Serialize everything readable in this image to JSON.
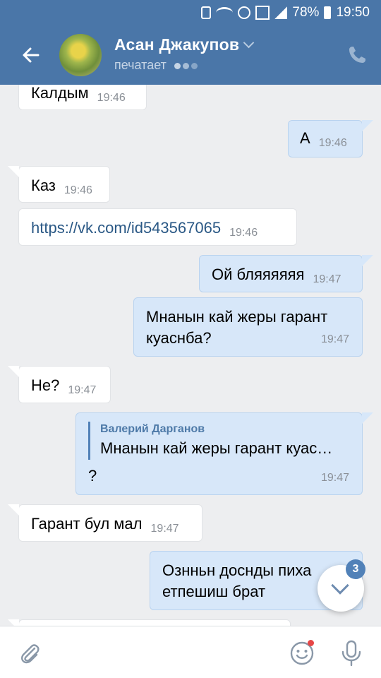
{
  "status_bar": {
    "battery": "78%",
    "time": "19:50"
  },
  "header": {
    "contact_name": "Асан Джакупов",
    "status": "печатает"
  },
  "messages": [
    {
      "type": "in",
      "text": "Калдым",
      "time": "19:46"
    },
    {
      "type": "out",
      "text": "А",
      "time": "19:46"
    },
    {
      "type": "in",
      "text": "Каз",
      "time": "19:46"
    },
    {
      "type": "in",
      "text": "https://vk.com/id543567065",
      "time": "19:46"
    },
    {
      "type": "out",
      "text": "Ой бляяяяяя",
      "time": "19:47"
    },
    {
      "type": "out",
      "text_line1": "Мнанын кай жеры гарант",
      "text_line2": "куаснба?",
      "time": "19:47"
    },
    {
      "type": "in",
      "text": "Не?",
      "time": "19:47"
    },
    {
      "type": "out",
      "reply_author": "Валерий Дарганов",
      "reply_text": "Мнанын кай жеры гарант куас…",
      "text": "?",
      "time": "19:47"
    },
    {
      "type": "in",
      "text": "Гарант бул мал",
      "time": "19:47"
    },
    {
      "type": "out",
      "text_line1": "Ознньн доснды пиха",
      "text_line2": "етпешиш брат",
      "time": ""
    }
  ],
  "scroll_down": {
    "unread_count": "3"
  },
  "icons": {
    "back": "arrow-left-icon",
    "phone": "phone-icon",
    "attach": "paperclip-icon",
    "emoji": "smile-icon",
    "mic": "microphone-icon"
  },
  "colors": {
    "header_bg": "#4a76a8",
    "outgoing_bubble": "#d7e7f9",
    "incoming_bubble": "#ffffff",
    "chat_bg": "#edeef0",
    "link": "#2a5885",
    "badge": "#5181b8"
  }
}
